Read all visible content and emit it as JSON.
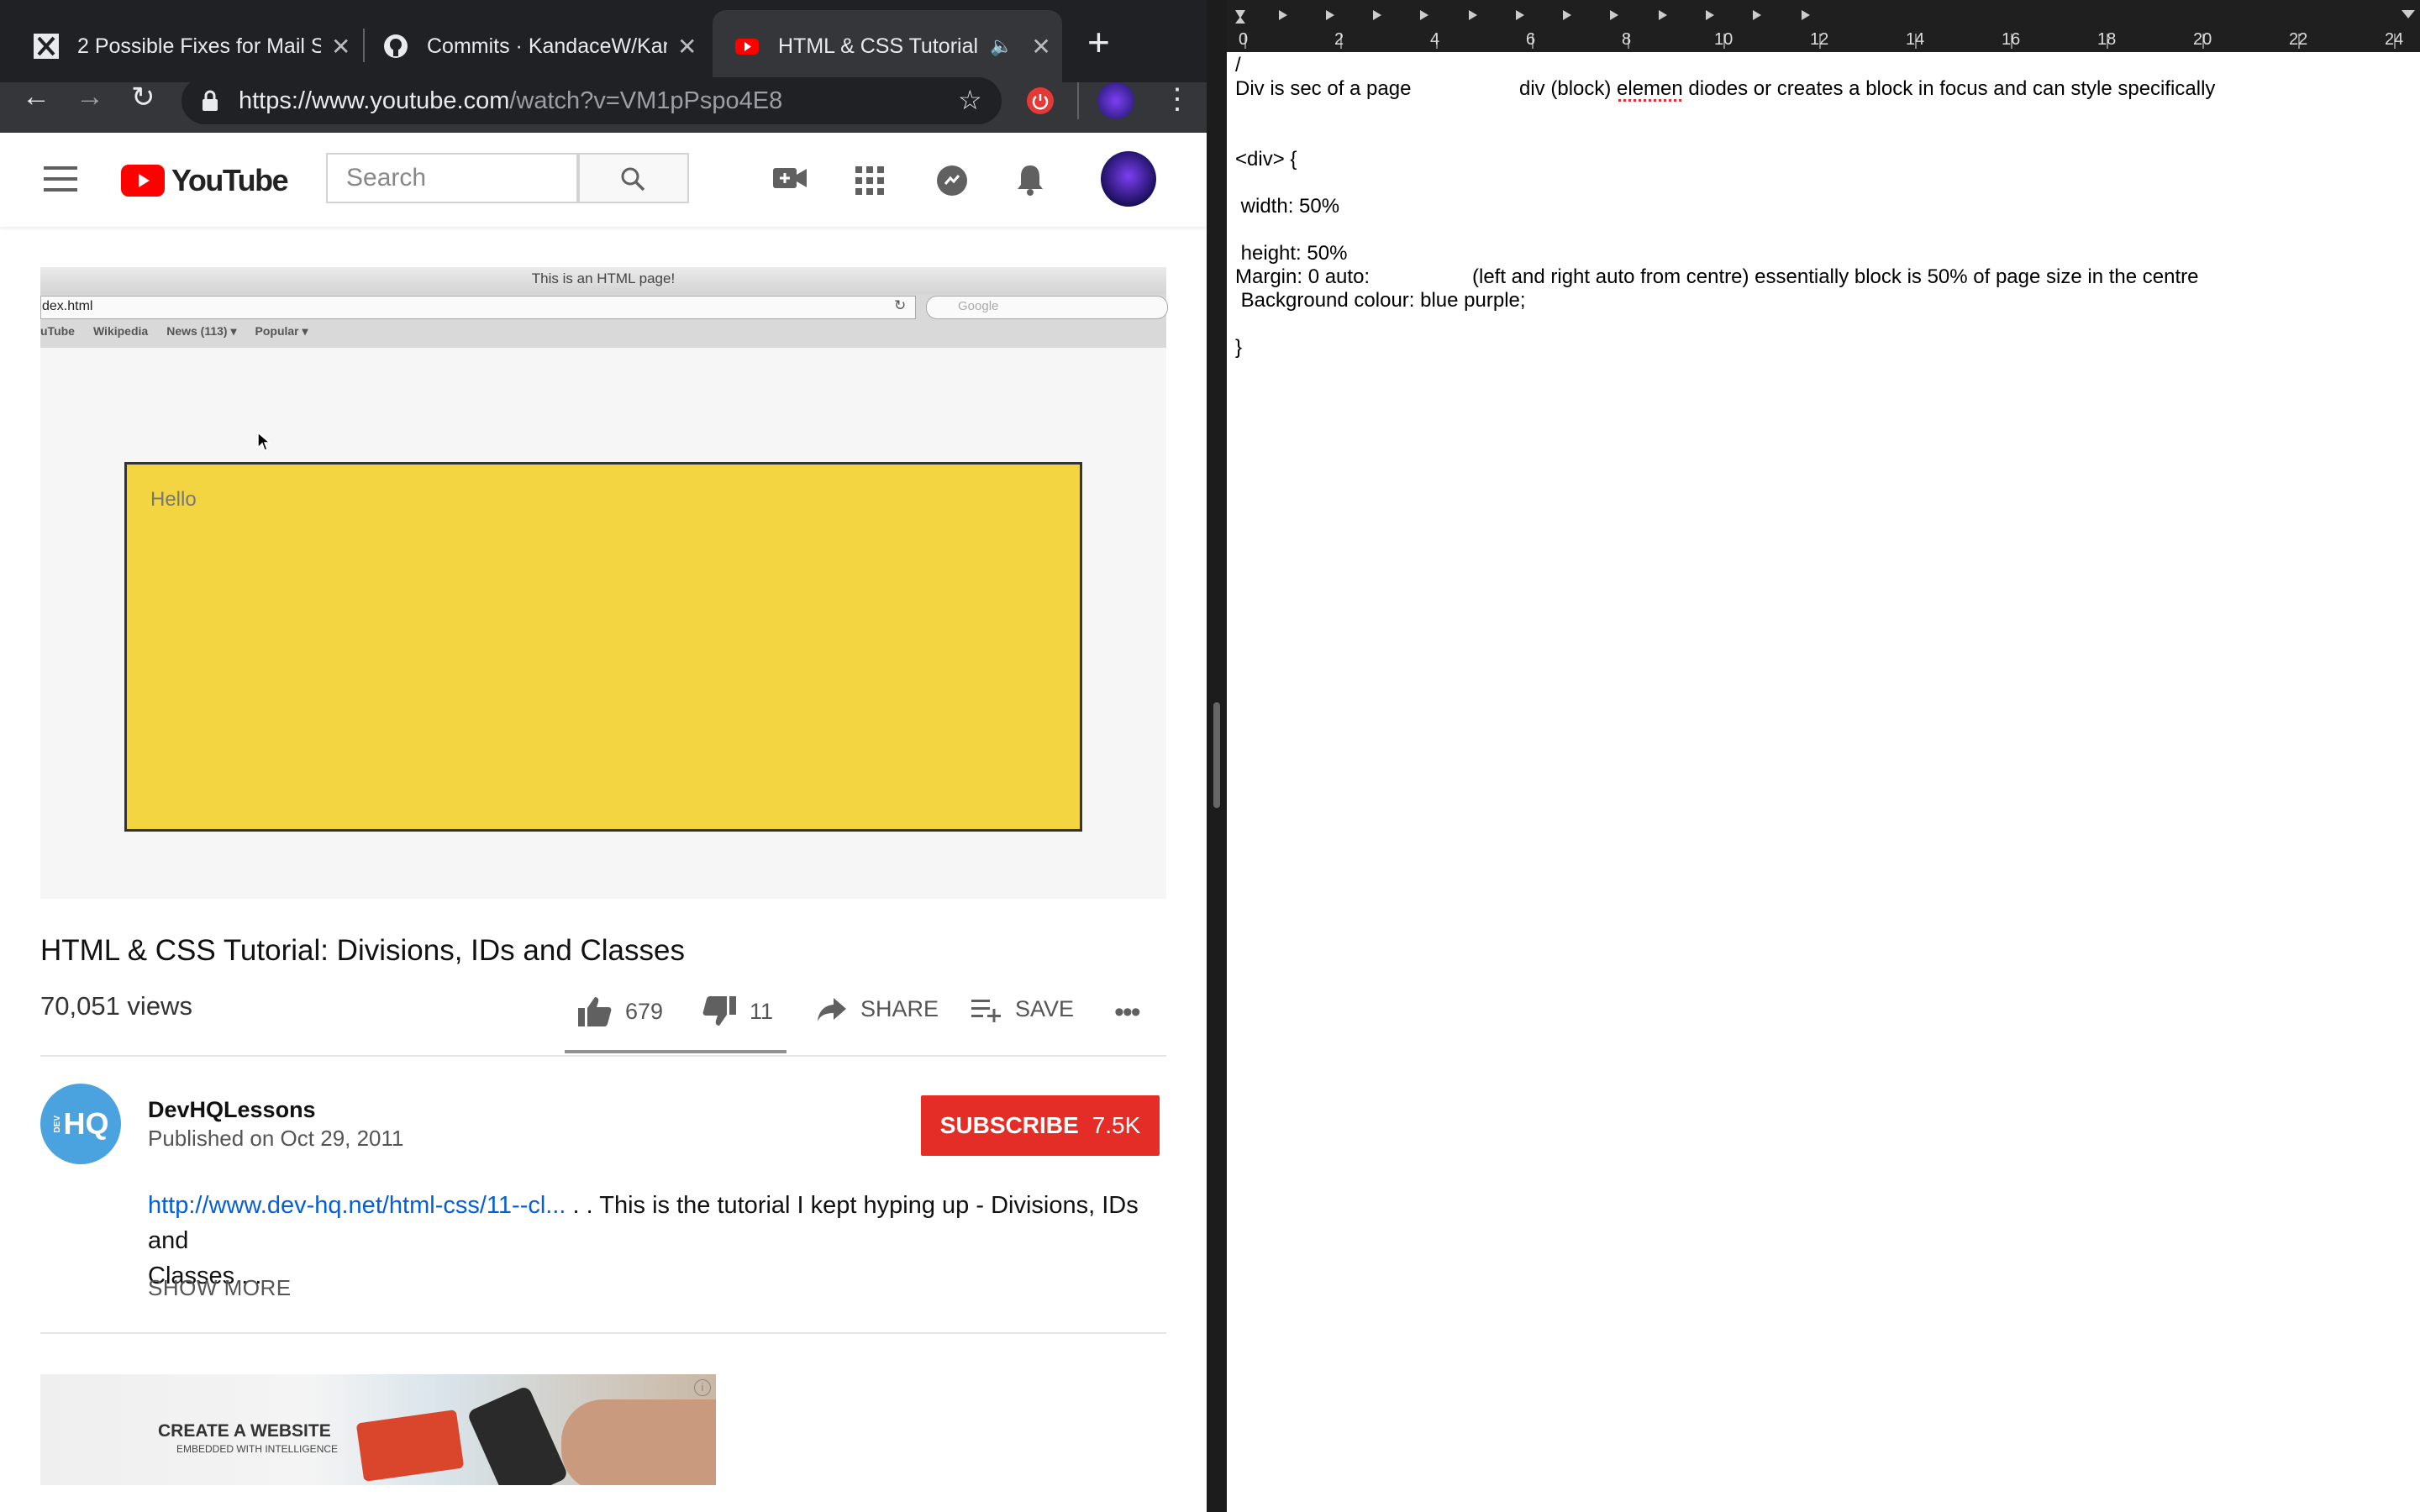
{
  "tabs": [
    {
      "title": "2 Possible Fixes for Mail S",
      "icon": "x-logo-icon"
    },
    {
      "title": "Commits · KandaceW/Kar",
      "icon": "github-icon"
    },
    {
      "title": "HTML & CSS Tutorial",
      "icon": "youtube-icon",
      "active": true
    }
  ],
  "browser": {
    "url_main": "https://www.youtube.com",
    "url_path": "/watch?v=VM1pPspo4E8"
  },
  "youtube": {
    "logo_text": "YouTube",
    "search_placeholder": "Search"
  },
  "video_frame": {
    "window_title": "This is an HTML page!",
    "address": "dex.html",
    "search_hint": "Google",
    "bookmarks": [
      "uTube",
      "Wikipedia",
      "News (113) ▾",
      "Popular ▾"
    ],
    "box_text": "Hello"
  },
  "video": {
    "title": "HTML & CSS Tutorial: Divisions, IDs and Classes",
    "views": "70,051 views",
    "likes": "679",
    "dislikes": "11",
    "share_label": "SHARE",
    "save_label": "SAVE"
  },
  "channel": {
    "avatar_text": "HQ",
    "avatar_small": "DEV",
    "name": "DevHQLessons",
    "published": "Published on Oct 29, 2011",
    "subscribe_label": "SUBSCRIBE",
    "subscriber_count": "7.5K"
  },
  "description": {
    "link": "http://www.dev-hq.net/html-css/11--cl...",
    "text_line1": " . . This is the tutorial I kept hyping up - Divisions, IDs and",
    "text_line2": "Classes . .",
    "show_more": "SHOW MORE"
  },
  "ad": {
    "headline": "CREATE A WEBSITE",
    "subline": "EMBEDDED WITH INTELLIGENCE",
    "info": "i"
  },
  "ruler": {
    "numbers": [
      "0",
      "2",
      "4",
      "6",
      "8",
      "10",
      "12",
      "14",
      "16",
      "18",
      "20",
      "22",
      "24"
    ]
  },
  "document": {
    "line0": "/",
    "line1a": "Div is sec of a page",
    "line1b": "div (block) elemen diodes or creates a block in focus and can style specifically",
    "line2": "<div> {",
    "line3": " width: 50%",
    "line4": " height: 50%",
    "line5a": "Margin: 0 auto:",
    "line5b": "(left and right auto from centre) essentially block is 50% of page size in the centre",
    "line6": " Background colour: blue purple;",
    "line7": "}"
  },
  "colors": {
    "youtube_red": "#e52d27",
    "link_blue": "#065fd4",
    "video_yellow": "#f3d542"
  }
}
